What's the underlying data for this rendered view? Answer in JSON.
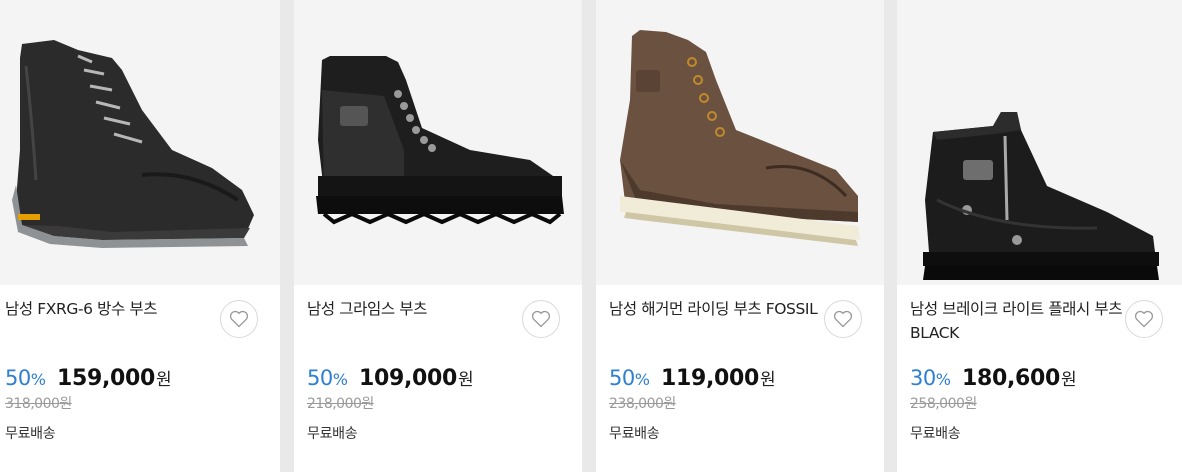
{
  "products": [
    {
      "name": "남성 FXRG-6 방수 부츠",
      "discount_number": "50",
      "discount_sign": "%",
      "price": "159,000",
      "currency": "원",
      "original_price": "318,000원",
      "shipping": "무료배송",
      "image": "black-waterproof-riding-boot",
      "wishlist_icon": "heart-outline-icon"
    },
    {
      "name": "남성 그라임스 부츠",
      "discount_number": "50",
      "discount_sign": "%",
      "price": "109,000",
      "currency": "원",
      "original_price": "218,000원",
      "shipping": "무료배송",
      "image": "black-lace-up-boot",
      "wishlist_icon": "heart-outline-icon"
    },
    {
      "name": "남성 해거먼 라이딩 부츠 FOSSIL",
      "discount_number": "50",
      "discount_sign": "%",
      "price": "119,000",
      "currency": "원",
      "original_price": "238,000원",
      "shipping": "무료배송",
      "image": "brown-moc-toe-boot",
      "wishlist_icon": "heart-outline-icon"
    },
    {
      "name": "남성 브레이크 라이트 플래시 부츠 BLACK",
      "discount_number": "30",
      "discount_sign": "%",
      "price": "180,600",
      "currency": "원",
      "original_price": "258,000원",
      "shipping": "무료배송",
      "image": "black-zip-riding-boot",
      "wishlist_icon": "heart-outline-icon"
    }
  ],
  "colors": {
    "discount": "#2f7fd3",
    "original_price": "#9a9a9a",
    "background": "#e9e9e9",
    "card": "#ffffff",
    "image_bg": "#f4f4f4"
  }
}
